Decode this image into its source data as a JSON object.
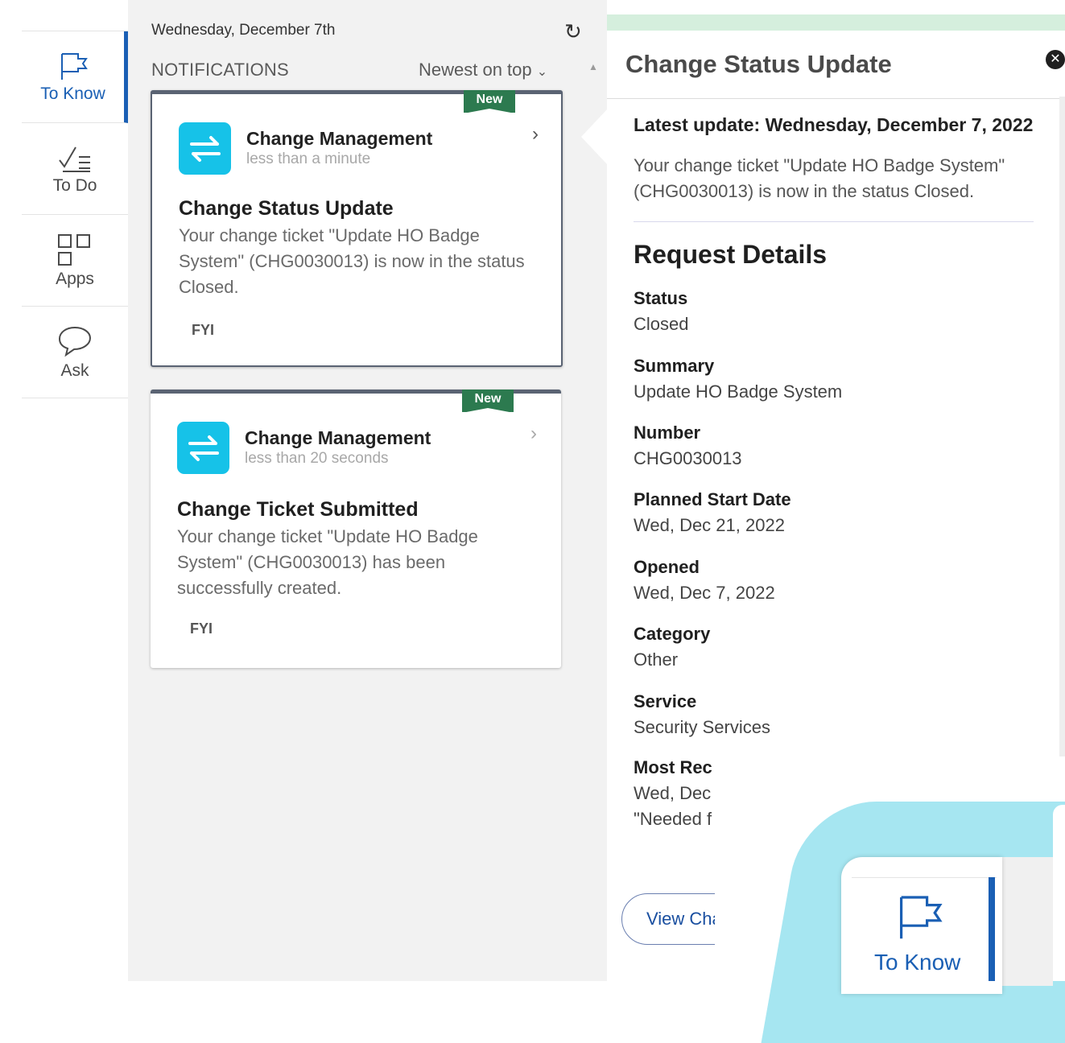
{
  "sidebar": {
    "items": [
      {
        "label": "To Know",
        "icon": "flag-icon",
        "active": true
      },
      {
        "label": "To Do",
        "icon": "checklist-icon",
        "active": false
      },
      {
        "label": "Apps",
        "icon": "apps-grid-icon",
        "active": false
      },
      {
        "label": "Ask",
        "icon": "chat-bubble-icon",
        "active": false
      }
    ]
  },
  "feed": {
    "date": "Wednesday, December 7th",
    "heading": "NOTIFICATIONS",
    "sort": "Newest on top",
    "cards": [
      {
        "badge": "New",
        "app": "Change Management",
        "time": "less than a minute",
        "title": "Change Status Update",
        "body": "Your change ticket \"Update HO Badge System\" (CHG0030013) is now in the status Closed.",
        "tag": "FYI"
      },
      {
        "badge": "New",
        "app": "Change Management",
        "time": "less than 20 seconds",
        "title": "Change Ticket Submitted",
        "body": "Your change ticket \"Update HO Badge System\" (CHG0030013) has been successfully created.",
        "tag": "FYI"
      }
    ]
  },
  "detail": {
    "title": "Change Status Update",
    "latest": "Latest update: Wednesday, December 7, 2022",
    "latest_body": "Your change ticket \"Update HO Badge System\" (CHG0030013) is now in the status Closed.",
    "section": "Request Details",
    "fields": [
      {
        "label": "Status",
        "value": "Closed"
      },
      {
        "label": "Summary",
        "value": "Update HO Badge System"
      },
      {
        "label": "Number",
        "value": "CHG0030013"
      },
      {
        "label": "Planned Start Date",
        "value": "Wed, Dec 21, 2022"
      },
      {
        "label": "Opened",
        "value": "Wed, Dec 7, 2022"
      },
      {
        "label": "Category",
        "value": "Other"
      },
      {
        "label": "Service",
        "value": "Security Services"
      }
    ],
    "truncated": {
      "label": "Most Rec",
      "line1": "Wed, Dec",
      "line2": "\"Needed f"
    },
    "view_button": "View Cha"
  },
  "zoom": {
    "label": "To Know"
  },
  "colors": {
    "accent": "#1a5fb4",
    "badge_green": "#2c7a4f",
    "app_icon": "#16c2e8",
    "bubble": "#a6e6f1"
  }
}
